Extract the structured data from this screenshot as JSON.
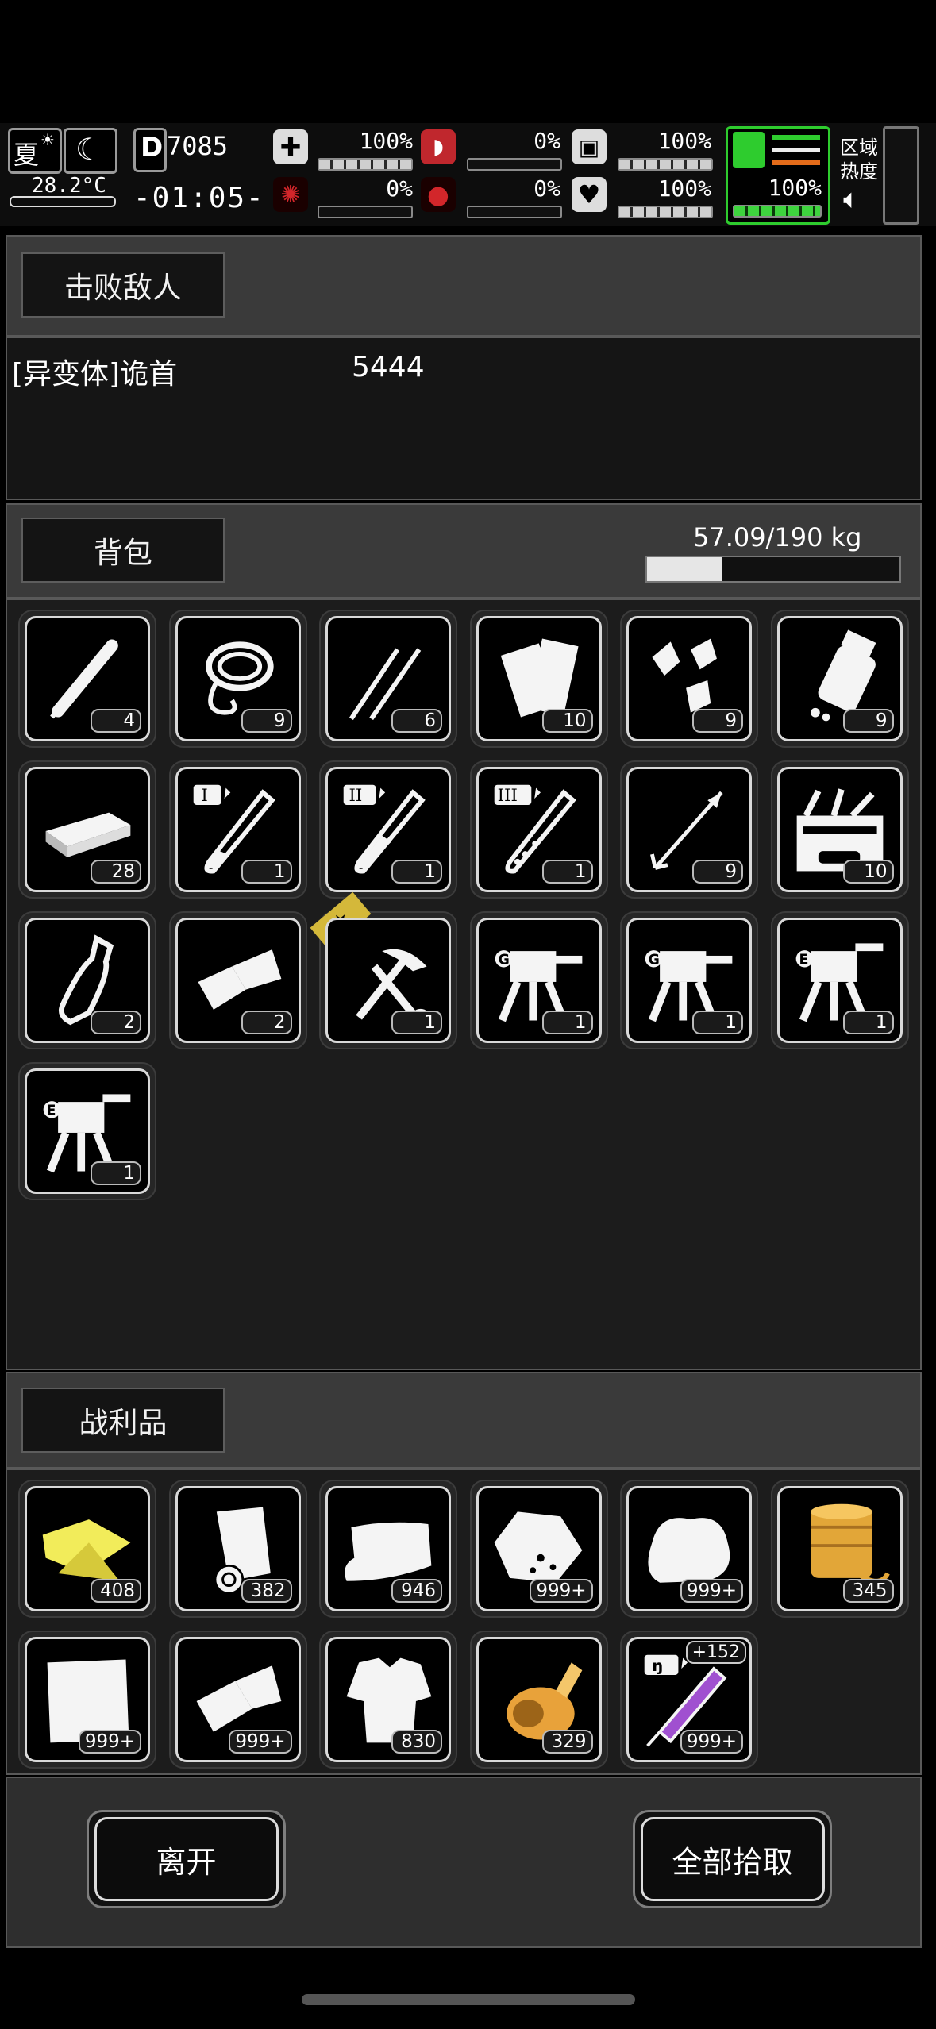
{
  "status": {
    "season": "夏",
    "temperature": "28.2°C",
    "day": "7085",
    "time": "-01:05-",
    "stats_top": [
      {
        "name": "health",
        "pct": "100%",
        "fill": 1.0
      },
      {
        "name": "hunger",
        "pct": "0%",
        "fill": 0.0
      },
      {
        "name": "thirst",
        "pct": "100%",
        "fill": 1.0
      }
    ],
    "stats_bottom": [
      {
        "name": "infection",
        "pct": "0%",
        "fill": 0.0
      },
      {
        "name": "bleeding",
        "pct": "0%",
        "fill": 0.0
      },
      {
        "name": "mood",
        "pct": "100%",
        "fill": 1.0
      }
    ],
    "stamina_pct": "100%",
    "region_heat_label": "区域热度",
    "colors": {
      "hunger": "#d2262a",
      "stamina": "#2ecc2e"
    }
  },
  "defeated": {
    "tab_label": "击败敌人",
    "enemy_name": "[异变体]诡首",
    "enemy_value": "5444"
  },
  "backpack": {
    "tab_label": "背包",
    "weight": "57.09/190 kg",
    "weight_fraction": 0.3,
    "items": [
      {
        "icon": "pen-icon",
        "count": "4"
      },
      {
        "icon": "rope-icon",
        "count": "9"
      },
      {
        "icon": "tweezers-icon",
        "count": "6"
      },
      {
        "icon": "scroll-icon",
        "count": "10"
      },
      {
        "icon": "shuttlecock-icon",
        "count": "9"
      },
      {
        "icon": "pill-bottle-icon",
        "count": "9"
      },
      {
        "icon": "cash-bundle-icon",
        "count": "28"
      },
      {
        "icon": "test-tube-1-icon",
        "count": "1"
      },
      {
        "icon": "test-tube-2-icon",
        "count": "1"
      },
      {
        "icon": "test-tube-3-icon",
        "count": "1"
      },
      {
        "icon": "arrow-icon",
        "count": "9"
      },
      {
        "icon": "toolbox-icon",
        "count": "10"
      },
      {
        "icon": "bottle-icon",
        "count": "2"
      },
      {
        "icon": "cloth-icon",
        "count": "2"
      },
      {
        "icon": "hammer-wrench-icon",
        "count": "1"
      },
      {
        "icon": "turret-g-icon",
        "count": "1"
      },
      {
        "icon": "turret-g-icon",
        "count": "1"
      },
      {
        "icon": "turret-e-icon",
        "count": "1"
      },
      {
        "icon": "turret-e-icon",
        "count": "1"
      }
    ]
  },
  "loot": {
    "tab_label": "战利品",
    "items": [
      {
        "icon": "yellow-cloth-icon",
        "count": "408"
      },
      {
        "icon": "paper-roll-icon",
        "count": "382"
      },
      {
        "icon": "towel-icon",
        "count": "946"
      },
      {
        "icon": "ore-icon",
        "count": "999+"
      },
      {
        "icon": "cotton-icon",
        "count": "999+"
      },
      {
        "icon": "gold-spool-icon",
        "count": "345"
      },
      {
        "icon": "white-cloth-icon",
        "count": "999+"
      },
      {
        "icon": "folded-cloth-icon",
        "count": "999+"
      },
      {
        "icon": "tattered-shirt-icon",
        "count": "830"
      },
      {
        "icon": "gold-roll-icon",
        "count": "329"
      },
      {
        "icon": "purple-syringe-icon",
        "count": "999+",
        "badge": "+152"
      }
    ]
  },
  "buttons": {
    "leave": "离开",
    "take_all": "全部拾取"
  }
}
